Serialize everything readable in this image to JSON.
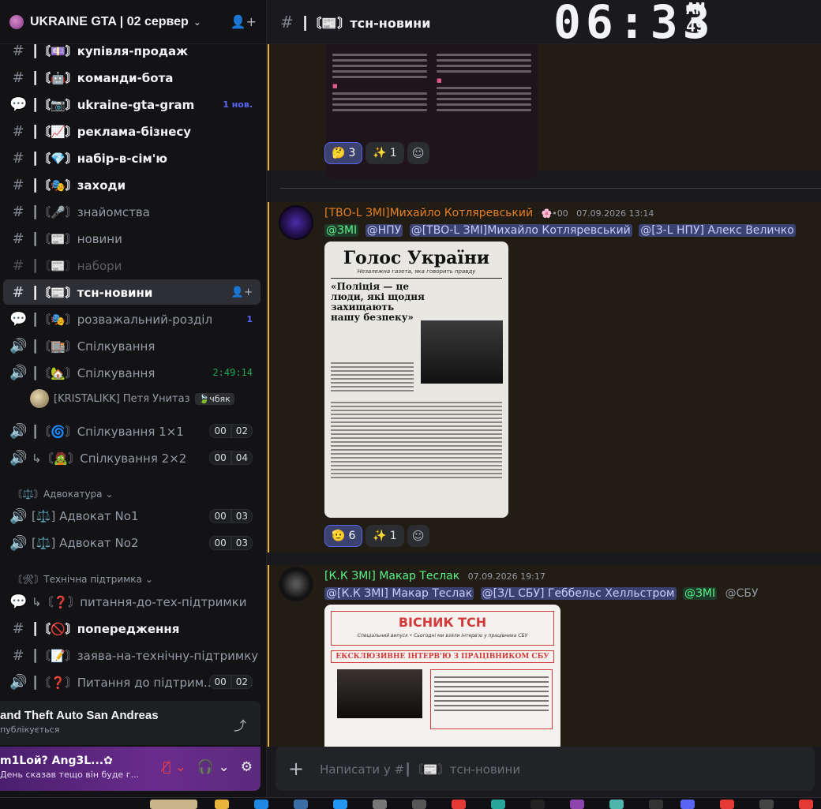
{
  "server": {
    "name": "UKRAINE GTA | 02 сервер",
    "chevron": "⌄"
  },
  "sidebar": {
    "channels": [
      {
        "label": "┃〘💷〙купівля-продаж",
        "icon": "#",
        "state": "unread"
      },
      {
        "label": "┃〘🤖〙команди-бота",
        "icon": "#",
        "state": "unread"
      },
      {
        "label": "┃〘📷〙ukraine-gta-gram",
        "icon": "forum",
        "state": "unread",
        "badge": "1 нов."
      },
      {
        "label": "┃〘📈〙реклама-бізнесу",
        "icon": "#",
        "state": "unread"
      },
      {
        "label": "┃〘💎〙набір-в-сім'ю",
        "icon": "#",
        "state": "unread"
      },
      {
        "label": "┃〘🎭〙заходи",
        "icon": "#",
        "state": "unread"
      },
      {
        "label": "┃〘🎤〙знайомства",
        "icon": "#",
        "state": "normal"
      },
      {
        "label": "┃〘📰〙новини",
        "icon": "#",
        "state": "normal"
      },
      {
        "label": "┃〘📰〙набори",
        "icon": "#lock",
        "state": "muted"
      },
      {
        "label": "┃〘📰〙тсн-новини",
        "icon": "#",
        "state": "active"
      },
      {
        "label": "┃〘🎭〙розважальний-розділ",
        "icon": "forum",
        "state": "normal",
        "badge": "1"
      },
      {
        "label": "┃〘🏬〙Спілкування",
        "icon": "voice",
        "state": "normal"
      },
      {
        "label": "┃〘🏡〙Спілкування",
        "icon": "voice-active",
        "state": "normal",
        "timer": "2:49:14"
      },
      {
        "label": "┃〘🌀〙Спілкування 1×1",
        "icon": "voice",
        "state": "normal",
        "count": [
          "00",
          "02"
        ]
      },
      {
        "label": "↳〘🧟〙Спілкування 2×2",
        "icon": "voice",
        "state": "normal",
        "count": [
          "00",
          "04"
        ]
      }
    ],
    "voice_user": {
      "name": "[KRISTALIKK] Петя Унитаз",
      "tag": "чбяк"
    },
    "categories": [
      {
        "label": "〘⚖️〙Адвокатура"
      },
      {
        "label": "〘🛠〙Технічна підтримка"
      }
    ],
    "lawyer_channels": [
      {
        "label": "[⚖️] Адвокат No1",
        "count": [
          "00",
          "03"
        ]
      },
      {
        "label": "[⚖️] Адвокат No2",
        "count": [
          "00",
          "03"
        ]
      }
    ],
    "support_channels": [
      {
        "label": "↳〘❓〙питання-до-тех-підтримки",
        "icon": "forum",
        "state": "normal"
      },
      {
        "label": "┃〘🚫〙попередження",
        "icon": "#",
        "state": "unread"
      },
      {
        "label": "┃〘📝〙заява-на-технічну-підтримку",
        "icon": "#",
        "state": "normal"
      },
      {
        "label": "┃〘❓〙Питання до підтрим...",
        "icon": "voice",
        "state": "normal",
        "count": [
          "00",
          "02"
        ]
      }
    ]
  },
  "activity": {
    "title": "and Theft Auto San Andreas",
    "sub": "публікується"
  },
  "user": {
    "name": "m1Lой? Ang3L...✿",
    "status": "День сказав тещо він буде г..."
  },
  "header": {
    "channel": "┃〘📰〙тсн-новини",
    "clock": "06:33",
    "ampm": "AM",
    "seconds": "49"
  },
  "messages": [
    {
      "reactions": [
        {
          "emoji": "🤔",
          "count": "3",
          "me": true
        },
        {
          "emoji": "✨",
          "count": "1",
          "me": false
        }
      ]
    },
    {
      "author": "[ТВО-L ЗМІ]Михайло Котляревський",
      "author_color": "#e67e22",
      "badge": "🌸•00",
      "time": "07.09.2026 13:14",
      "mentions": [
        "@ЗМІ",
        "@НПУ",
        "@[ТВО-L ЗМІ]Михайло Котляревський",
        "@[З-L НПУ] Алекс Величко"
      ],
      "newspaper": {
        "title": "Голос України",
        "subtitle": "Незалежна газета, яка говорить правду",
        "headline": "«Поліція — це люди, які щодня захищають нашу безпеку»"
      },
      "reactions": [
        {
          "emoji": "🫡",
          "count": "6",
          "me": true
        },
        {
          "emoji": "✨",
          "count": "1",
          "me": false
        }
      ]
    },
    {
      "author": "[К.К ЗМІ] Макар Теслак",
      "author_color": "#57f287",
      "time": "07.09.2026 19:17",
      "mentions": [
        "@[К.К ЗМІ] Макар Теслак",
        "@[З/L СБУ] Геббельс Хелльстром",
        "@ЗМІ",
        "@СБУ"
      ],
      "poster": {
        "title": "ВІСНИК ТСН",
        "subtitle": "Спеціальний випуск • Сьогодні ми взяли інтерв'ю у працівника СБУ",
        "bar": "ЕКСКЛЮЗИВНЕ ІНТЕРВ'Ю З ПРАЦІВНИКОМ СБУ"
      }
    }
  ],
  "composer": {
    "placeholder": "Написати у #┃〘📰〙тсн-новини"
  }
}
